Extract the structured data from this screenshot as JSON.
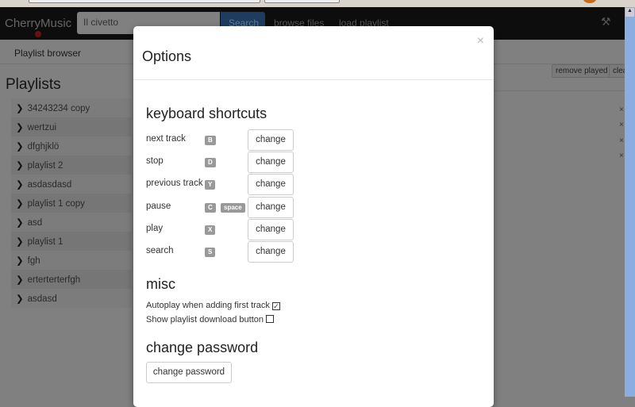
{
  "navbar": {
    "brand": "CherryMusic",
    "search_value": "Il civetto",
    "search_button": "Search",
    "links": [
      "browse files",
      "load playlist"
    ]
  },
  "tabbar": {
    "label": "Playlist browser"
  },
  "sidebar": {
    "title": "Playlists",
    "items": [
      "34243234 copy",
      "wertzui",
      "dfghjklö",
      "playlist 2",
      "asdasdasd",
      "playlist 1 copy",
      "asd",
      "playlist 1",
      "fgh",
      "erterterterfgh",
      "asdasd"
    ]
  },
  "queue": {
    "remove_played": "remove played",
    "clear": "clear"
  },
  "modal": {
    "title": "Options",
    "close": "×",
    "shortcuts_heading": "keyboard shortcuts",
    "shortcuts": [
      {
        "label": "next track",
        "keys": [
          "B"
        ],
        "button": "change"
      },
      {
        "label": "stop",
        "keys": [
          "D"
        ],
        "button": "change"
      },
      {
        "label": "previous track",
        "keys": [
          "Y"
        ],
        "button": "change"
      },
      {
        "label": "pause",
        "keys": [
          "C",
          "space"
        ],
        "button": "change"
      },
      {
        "label": "play",
        "keys": [
          "X"
        ],
        "button": "change"
      },
      {
        "label": "search",
        "keys": [
          "S"
        ],
        "button": "change"
      }
    ],
    "misc_heading": "misc",
    "misc": [
      {
        "label": "Autoplay when adding first track",
        "checked": true
      },
      {
        "label": "Show playlist download button",
        "checked": false
      }
    ],
    "password_heading": "change password",
    "password_button": "change password"
  }
}
